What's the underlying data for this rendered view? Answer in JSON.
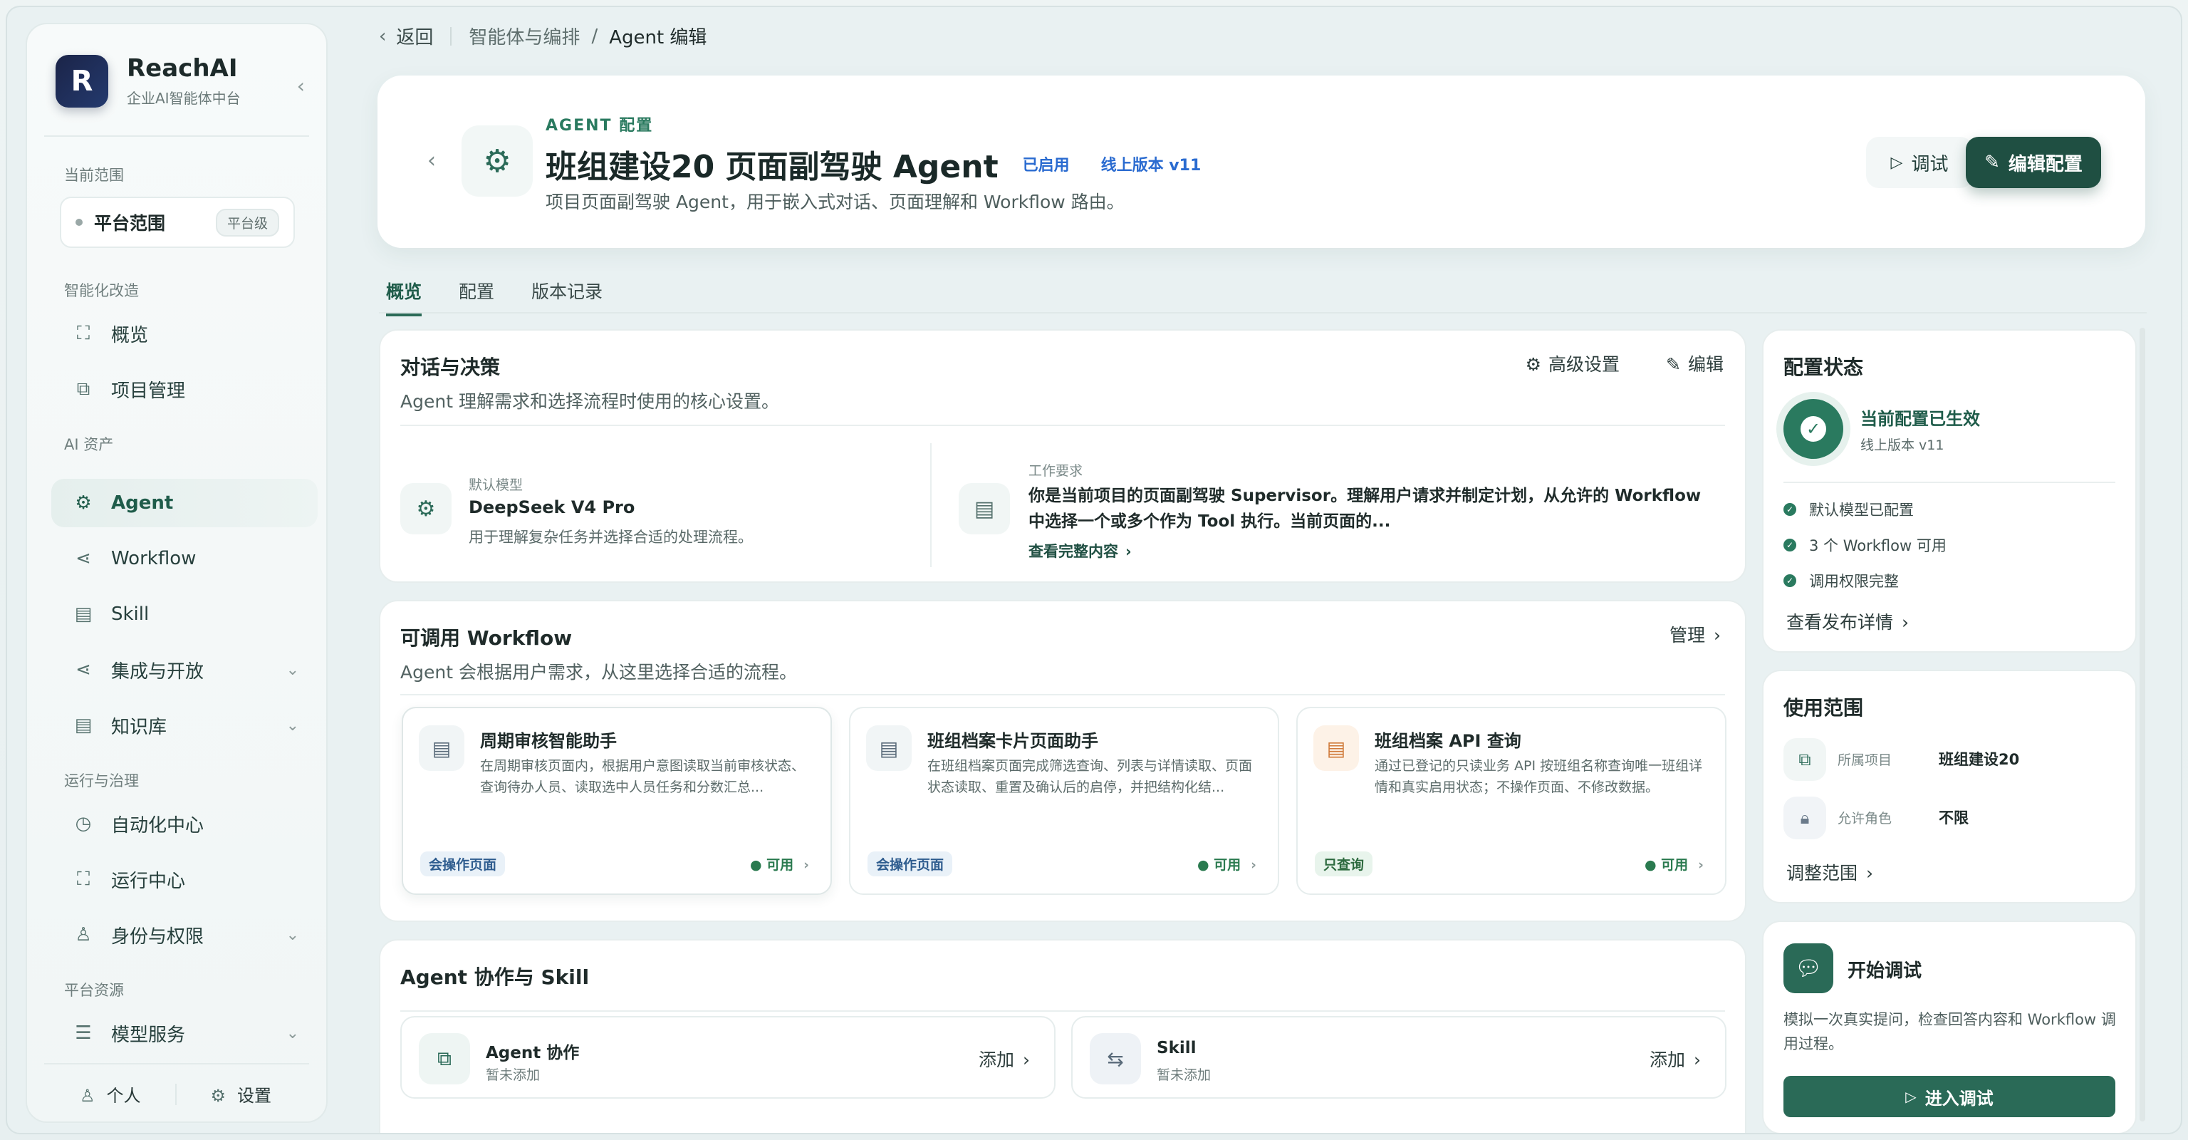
{
  "brand": {
    "name": "ReachAI",
    "subtitle": "企业AI智能体中台",
    "logo_letter": "R"
  },
  "sidebar": {
    "scope_heading": "当前范围",
    "scope": {
      "label": "平台范围",
      "pill": "平台级"
    },
    "groups": {
      "g1": "智能化改造",
      "g2": "AI 资产",
      "g3": "运行与治理",
      "g4": "平台资源"
    },
    "items": [
      {
        "label": "概览"
      },
      {
        "label": "项目管理"
      },
      {
        "label": "Agent"
      },
      {
        "label": "Workflow"
      },
      {
        "label": "Skill"
      },
      {
        "label": "集成与开放"
      },
      {
        "label": "知识库"
      },
      {
        "label": "自动化中心"
      },
      {
        "label": "运行中心"
      },
      {
        "label": "身份与权限"
      },
      {
        "label": "模型服务"
      }
    ],
    "footer": {
      "personal": "个人",
      "settings": "设置"
    }
  },
  "breadcrumb": {
    "back": "返回",
    "parent": "智能体与编排",
    "sep": "/",
    "current": "Agent 编辑"
  },
  "header": {
    "kicker": "AGENT 配置",
    "title": "班组建设20 页面副驾驶 Agent",
    "status": "已启用",
    "version": "线上版本 v11",
    "description": "项目页面副驾驶 Agent，用于嵌入式对话、页面理解和 Workflow 路由。",
    "debug_label": "调试",
    "edit_label": "编辑配置"
  },
  "tabs": [
    {
      "label": "概览"
    },
    {
      "label": "配置"
    },
    {
      "label": "版本记录"
    }
  ],
  "dialog": {
    "title": "对话与决策",
    "desc": "Agent 理解需求和选择流程时使用的核心设置。",
    "advanced": "高级设置",
    "edit": "编辑",
    "model_label": "默认模型",
    "model_name": "DeepSeek V4 Pro",
    "model_desc": "用于理解复杂任务并选择合适的处理流程。",
    "req_label": "工作要求",
    "req_text": "你是当前项目的页面副驾驶 Supervisor。理解用户请求并制定计划，从允许的 Workflow 中选择一个或多个作为 Tool 执行。当前页面的...",
    "req_link": "查看完整内容"
  },
  "workflows": {
    "title": "可调用 Workflow",
    "desc": "Agent 会根据用户需求，从这里选择合适的流程。",
    "manage": "管理",
    "items": [
      {
        "title": "周期审核智能助手",
        "desc": "在周期审核页面内，根据用户意图读取当前审核状态、查询待办人员、读取选中人员任务和分数汇总...",
        "tag": "会操作页面",
        "status": "可用"
      },
      {
        "title": "班组档案卡片页面助手",
        "desc": "在班组档案页面完成筛选查询、列表与详情读取、页面状态读取、重置及确认后的启停，并把结构化结...",
        "tag": "会操作页面",
        "status": "可用"
      },
      {
        "title": "班组档案 API 查询",
        "desc": "通过已登记的只读业务 API 按班组名称查询唯一班组详情和真实启用状态；不操作页面、不修改数据。",
        "tag": "只查询",
        "status": "可用"
      }
    ]
  },
  "collab": {
    "title": "Agent 协作与 Skill",
    "agent": {
      "title": "Agent 协作",
      "sub": "暂未添加",
      "add": "添加"
    },
    "skill": {
      "title": "Skill",
      "sub": "暂未添加",
      "add": "添加"
    }
  },
  "status_panel": {
    "title": "配置状态",
    "state": "当前配置已生效",
    "version": "线上版本 v11",
    "checks": [
      "默认模型已配置",
      "3 个 Workflow 可用",
      "调用权限完整"
    ],
    "link": "查看发布详情"
  },
  "scope_panel": {
    "title": "使用范围",
    "project_label": "所属项目",
    "project_value": "班组建设20",
    "role_label": "允许角色",
    "role_value": "不限",
    "link": "调整范围"
  },
  "debug_panel": {
    "title": "开始调试",
    "desc": "模拟一次真实提问，检查回答内容和 Workflow 调用过程。",
    "button": "进入调试"
  },
  "colors": {
    "accent": "#1f4f42",
    "primary": "#2a6a57",
    "link_blue": "#2a6bd0"
  }
}
